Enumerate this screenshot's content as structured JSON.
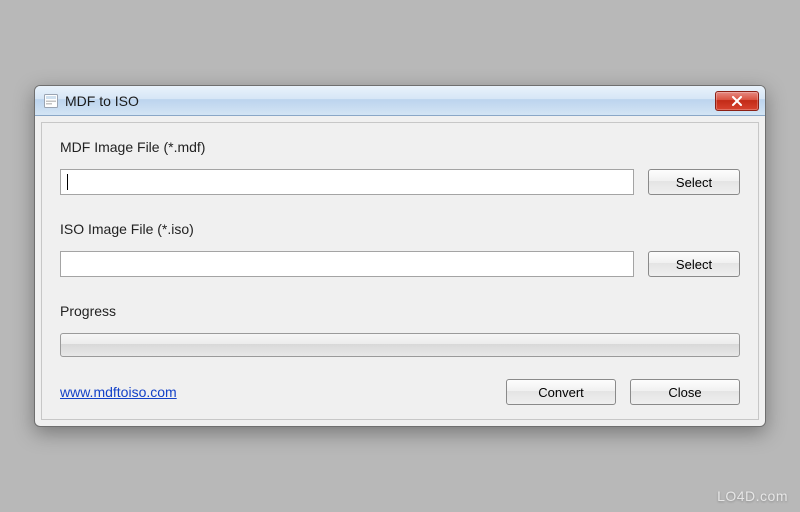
{
  "window": {
    "title": "MDF to ISO"
  },
  "fields": {
    "mdf": {
      "label": "MDF Image File (*.mdf)",
      "value": "",
      "select_label": "Select"
    },
    "iso": {
      "label": "ISO Image File (*.iso)",
      "value": "",
      "select_label": "Select"
    }
  },
  "progress": {
    "label": "Progress",
    "percent": 0
  },
  "footer": {
    "link_text": "www.mdftoiso.com",
    "convert_label": "Convert",
    "close_label": "Close"
  },
  "watermark": "LO4D.com"
}
